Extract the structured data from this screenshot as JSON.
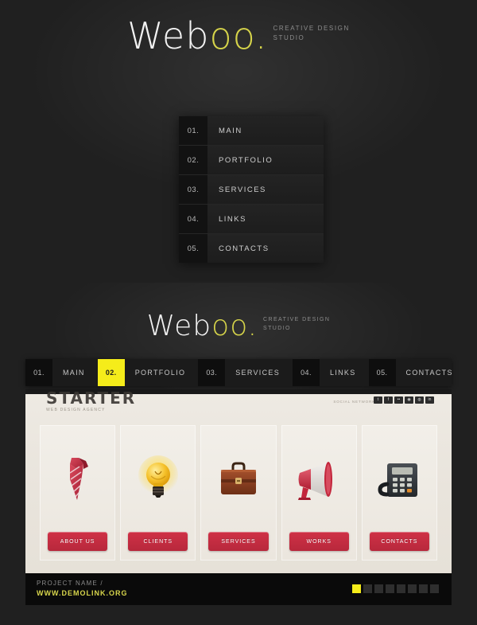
{
  "brand": {
    "name_white": "Web",
    "name_accent": "oo",
    "dot": ".",
    "tagline_line1": "Creative Design",
    "tagline_line2": "Studio",
    "accent_color": "#d6d44a",
    "highlight_color": "#f5ec1a",
    "button_color": "#c22e44"
  },
  "vertical_menu": {
    "items": [
      {
        "number": "01.",
        "label": "Main"
      },
      {
        "number": "02.",
        "label": "Portfolio"
      },
      {
        "number": "03.",
        "label": "Services"
      },
      {
        "number": "04.",
        "label": "Links"
      },
      {
        "number": "05.",
        "label": "Contacts"
      }
    ]
  },
  "horizontal_menu": {
    "items": [
      {
        "number": "01.",
        "label": "Main",
        "active": false
      },
      {
        "number": "02.",
        "label": "Portfolio",
        "active": true
      },
      {
        "number": "03.",
        "label": "Services",
        "active": false
      },
      {
        "number": "04.",
        "label": "Links",
        "active": false
      },
      {
        "number": "05.",
        "label": "Contacts",
        "active": false
      }
    ]
  },
  "preview": {
    "site_logo": "STARTER",
    "site_logo_sub": "Web Design Agency",
    "social_label": "Social Network",
    "social_icons": [
      "twitter-icon",
      "facebook-icon",
      "flickr-icon",
      "rss-icon",
      "vimeo-icon",
      "linkedin-icon"
    ],
    "cards": [
      {
        "icon": "necktie-icon",
        "button": "About Us"
      },
      {
        "icon": "lightbulb-icon",
        "button": "Clients"
      },
      {
        "icon": "briefcase-icon",
        "button": "Services"
      },
      {
        "icon": "megaphone-icon",
        "button": "Works"
      },
      {
        "icon": "telephone-icon",
        "button": "Contacts"
      }
    ]
  },
  "footer": {
    "project_label": "Project Name /",
    "project_url": "www.demolink.org",
    "pager_total": 8,
    "pager_active": 1
  }
}
